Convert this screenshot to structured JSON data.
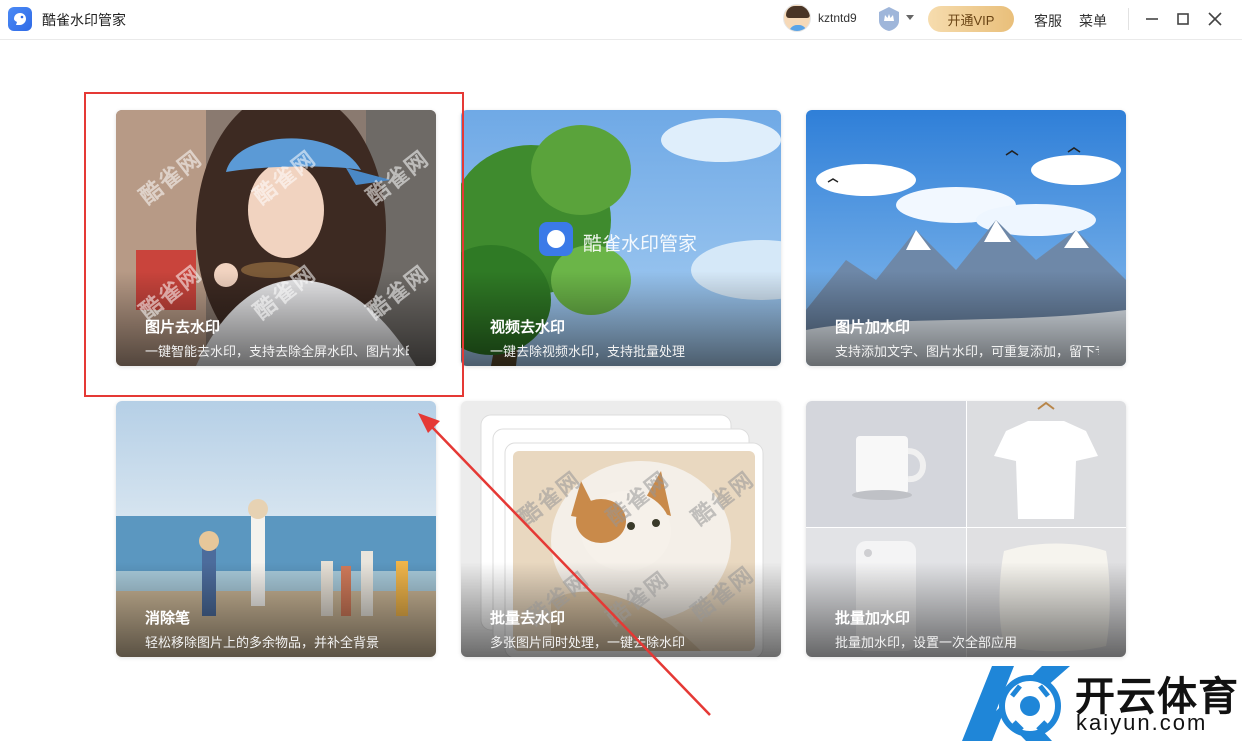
{
  "app": {
    "title": "酷雀水印管家"
  },
  "user": {
    "name": "kztntd9"
  },
  "header": {
    "vip_label": "开通VIP",
    "service_label": "客服",
    "menu_label": "菜单"
  },
  "cards": [
    {
      "title": "图片去水印",
      "desc": "一键智能去水印，支持去除全屏水印、图片水印"
    },
    {
      "title": "视频去水印",
      "desc": "一键去除视频水印，支持批量处理"
    },
    {
      "title": "图片加水印",
      "desc": "支持添加文字、图片水印，可重复添加，留下专属"
    },
    {
      "title": "消除笔",
      "desc": "轻松移除图片上的多余物品，并补全背景"
    },
    {
      "title": "批量去水印",
      "desc": "多张图片同时处理，一键去除水印"
    },
    {
      "title": "批量加水印",
      "desc": "批量加水印，设置一次全部应用"
    }
  ],
  "image_watermarks": {
    "site": "酷雀网",
    "video_brand": "酷雀水印管家"
  },
  "brand_watermark": {
    "cn": "开云体育",
    "en": "kaiyun.com"
  },
  "colors": {
    "accent": "#2f6ae6",
    "highlight": "#e53935",
    "vip_gold": "#e9bf7a"
  }
}
